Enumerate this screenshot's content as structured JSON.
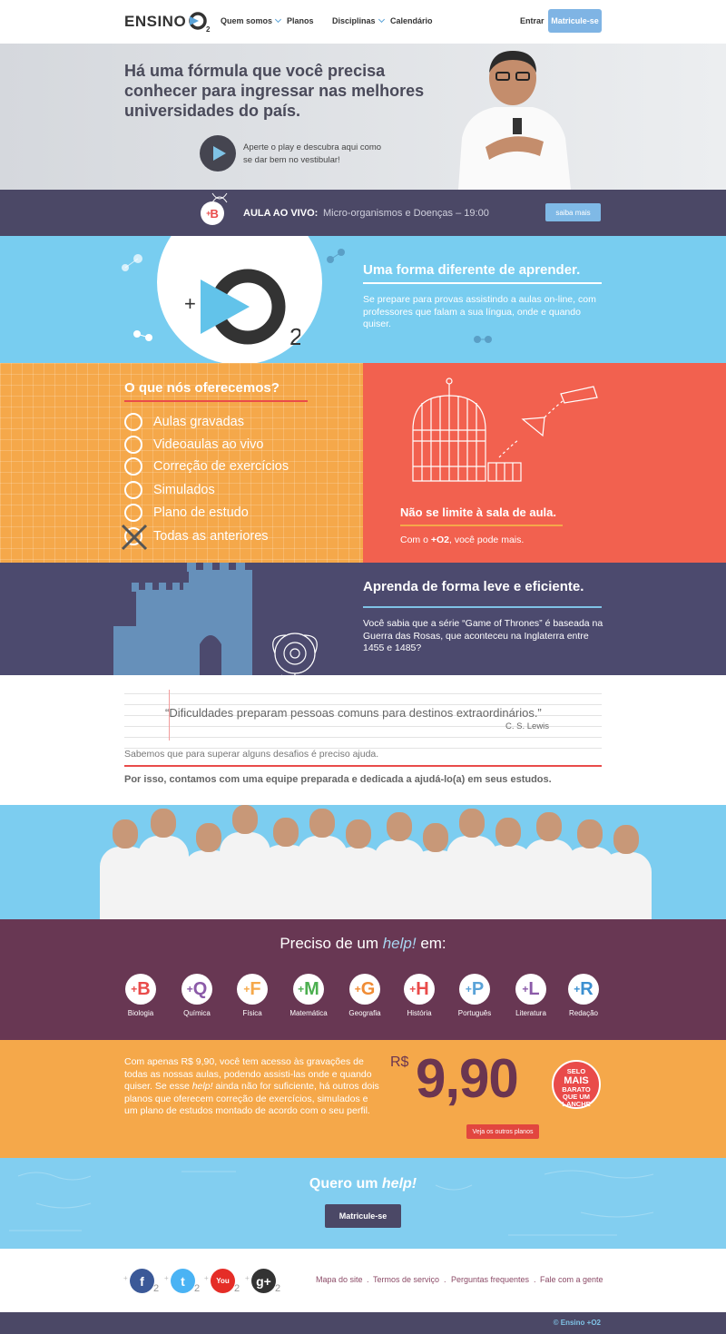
{
  "header": {
    "logo_text": "ENSINO",
    "logo_plus": "+",
    "logo_o2": "O",
    "logo_sub": "2",
    "nav": [
      "Quem somos",
      "Planos",
      "Disciplinas",
      "Calendário"
    ],
    "login": "Entrar",
    "signup": "Matricule-se"
  },
  "hero": {
    "headline": "Há uma fórmula que você precisa conhecer para ingressar nas melhores universidades do país.",
    "play_text": "Aperte o play e descubra aqui como se dar bem no vestibular!"
  },
  "live": {
    "badge": "B",
    "label": "AULA AO VIVO:",
    "topic": "Micro-organismos e Doenças – 19:00",
    "more": "saiba mais"
  },
  "intro": {
    "title": "Uma forma diferente de aprender.",
    "text": "Se prepare para provas assistindo a aulas on-line, com professores que falam a sua língua, onde e quando quiser.",
    "logo_sub": "2"
  },
  "offers": {
    "title": "O que nós oferecemos?",
    "items": [
      "Aulas gravadas",
      "Videoaulas ao vivo",
      "Correção de exercícios",
      "Simulados",
      "Plano de estudo",
      "Todas as anteriores"
    ],
    "right_title": "Não se limite à sala de aula.",
    "right_sub_pre": "Com o ",
    "right_sub_brand": "+O2",
    "right_sub_post": ", você pode mais."
  },
  "got": {
    "title": "Aprenda de forma leve e eficiente.",
    "text": "Você sabia que a série “Game of Thrones” é baseada na Guerra das Rosas, que aconteceu na Inglaterra entre 1455 e 1485?"
  },
  "quote": {
    "text": "“Dificuldades preparam pessoas comuns para destinos extraordinários.”",
    "author": "C. S. Lewis",
    "line1": "Sabemos que para superar alguns desafios é preciso ajuda.",
    "line2": "Por isso, contamos com uma equipe preparada e dedicada a ajudá-lo(a) em seus estudos."
  },
  "help": {
    "title_pre": "Preciso de um ",
    "title_em": "help!",
    "title_post": " em:",
    "subjects": [
      {
        "letter": "B",
        "name": "Biologia",
        "color": "#e94b4a"
      },
      {
        "letter": "Q",
        "name": "Química",
        "color": "#8b5aa8"
      },
      {
        "letter": "F",
        "name": "Física",
        "color": "#f5a84a"
      },
      {
        "letter": "M",
        "name": "Matemática",
        "color": "#4caf50"
      },
      {
        "letter": "G",
        "name": "Geografia",
        "color": "#f08c35"
      },
      {
        "letter": "H",
        "name": "História",
        "color": "#e94b4a"
      },
      {
        "letter": "P",
        "name": "Português",
        "color": "#5aa3d8"
      },
      {
        "letter": "L",
        "name": "Literatura",
        "color": "#8b5aa8"
      },
      {
        "letter": "R",
        "name": "Redação",
        "color": "#3b8fd0"
      }
    ]
  },
  "price": {
    "text_pre": "Com apenas R$ 9,90, você tem acesso às gravações de todas as nossas aulas, podendo assisti-las onde e quando quiser. Se esse ",
    "text_em": "help!",
    "text_post": " ainda não for suficiente, há outros dois planos que oferecem correção de exercícios, simulados e um plano de estudos montado de acordo com o seu perfil.",
    "currency": "R$",
    "amount": "9,90",
    "seal_top": "SELO",
    "seal_big": "MAIS",
    "seal_rest": "BARATO QUE UM LANCHE",
    "plans_btn": "Veja os outros planos"
  },
  "cta": {
    "title_pre": "Quero um ",
    "title_em": "help!",
    "button": "Matricule-se"
  },
  "footer": {
    "social": [
      {
        "icon": "facebook-icon",
        "glyph": "f",
        "color": "#3b5998"
      },
      {
        "icon": "twitter-icon",
        "glyph": "t",
        "color": "#4ab3f4"
      },
      {
        "icon": "youtube-icon",
        "glyph": "You",
        "color": "#e52d27"
      },
      {
        "icon": "googleplus-icon",
        "glyph": "g+",
        "color": "#333333"
      }
    ],
    "social_sub": "2",
    "links": [
      "Mapa do site",
      "Termos de serviço",
      "Perguntas frequentes",
      "Fale com a gente"
    ],
    "copyright": "© Ensino +O2"
  }
}
